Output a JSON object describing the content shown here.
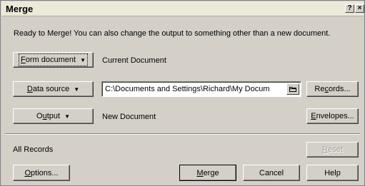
{
  "window": {
    "title": "Merge",
    "help_label": "?",
    "close_label": "×"
  },
  "intro_text": "Ready to Merge! You can also change the output to something other than a new document.",
  "form_document": {
    "label_pre": "",
    "label_key": "F",
    "label_post": "orm document",
    "value": "Current Document"
  },
  "data_source": {
    "label_pre": "",
    "label_key": "D",
    "label_post": "ata source",
    "path": "C:\\Documents and Settings\\Richard\\My Docum"
  },
  "output": {
    "label_pre": "O",
    "label_key": "u",
    "label_post": "tput",
    "value": "New Document"
  },
  "records_button": {
    "pre": "Re",
    "key": "c",
    "post": "ords..."
  },
  "envelopes_button": {
    "pre": "",
    "key": "E",
    "post": "nvelopes..."
  },
  "records_status": "All Records",
  "reset_button": {
    "pre": "",
    "key": "R",
    "post": "eset"
  },
  "options_button": {
    "pre": "",
    "key": "O",
    "post": "ptions..."
  },
  "merge_button": {
    "pre": "",
    "key": "M",
    "post": "erge"
  },
  "cancel_label": "Cancel",
  "help_label": "Help",
  "icons": {
    "dropdown": "caret-down-icon",
    "browse": "folder-icon"
  }
}
